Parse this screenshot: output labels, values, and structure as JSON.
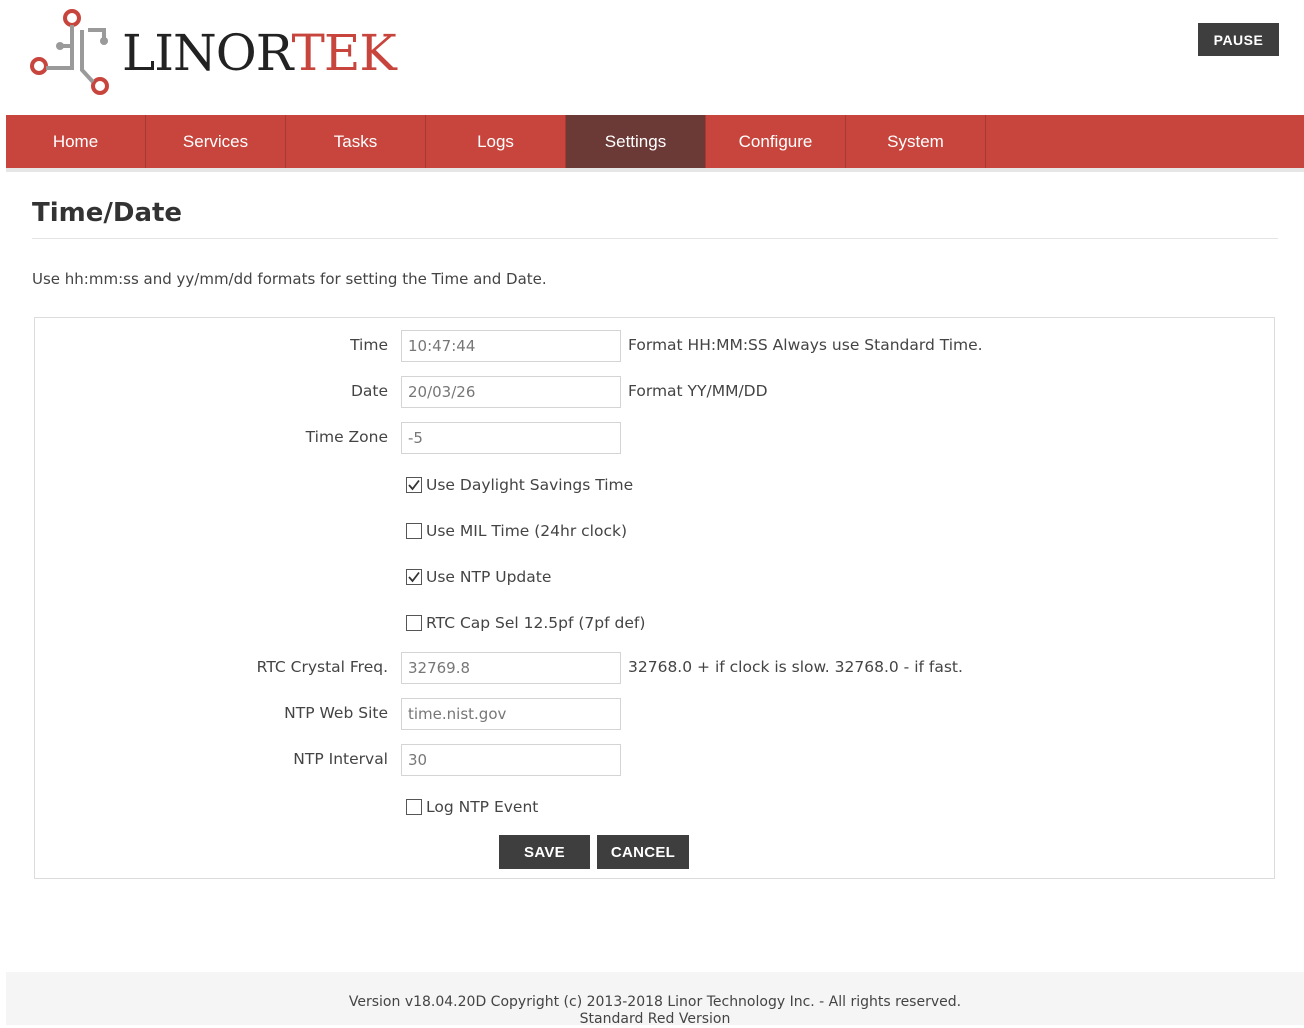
{
  "header": {
    "logo": {
      "text_dark": "LINOR",
      "text_red": "TEK",
      "icon": "circuit-logo-icon"
    },
    "pause_label": "PAUSE"
  },
  "nav": {
    "items": [
      {
        "label": "Home"
      },
      {
        "label": "Services"
      },
      {
        "label": "Tasks"
      },
      {
        "label": "Logs"
      },
      {
        "label": "Settings"
      },
      {
        "label": "Configure"
      },
      {
        "label": "System"
      }
    ],
    "active": "Settings"
  },
  "page": {
    "title": "Time/Date",
    "intro": "Use hh:mm:ss and yy/mm/dd formats for setting the Time and Date."
  },
  "form": {
    "time": {
      "label": "Time",
      "value": "10:47:44",
      "hint": "Format HH:MM:SS Always use Standard Time."
    },
    "date": {
      "label": "Date",
      "value": "20/03/26",
      "hint": "Format YY/MM/DD"
    },
    "timezone": {
      "label": "Time Zone",
      "value": "-5"
    },
    "dst": {
      "label": "Use Daylight Savings Time",
      "checked": true
    },
    "mil": {
      "label": "Use MIL Time (24hr clock)",
      "checked": false
    },
    "ntp_update": {
      "label": "Use NTP Update",
      "checked": true
    },
    "rtc_cap": {
      "label": "RTC Cap Sel 12.5pf (7pf def)",
      "checked": false
    },
    "rtc_freq": {
      "label": "RTC Crystal Freq.",
      "value": "32769.8",
      "hint": "32768.0 + if clock is slow. 32768.0 - if fast."
    },
    "ntp_site": {
      "label": "NTP Web Site",
      "value": "time.nist.gov"
    },
    "ntp_interval": {
      "label": "NTP Interval",
      "value": "30"
    },
    "log_ntp": {
      "label": "Log NTP Event",
      "checked": false
    },
    "save_label": "SAVE",
    "cancel_label": "CANCEL"
  },
  "footer": {
    "line1": "Version v18.04.20D Copyright (c) 2013-2018 Linor Technology Inc. - All rights reserved.",
    "line2": "Standard Red Version"
  },
  "colors": {
    "accent": "#c8453d",
    "nav_active": "#6b3a37",
    "button": "#3e3e3e"
  }
}
